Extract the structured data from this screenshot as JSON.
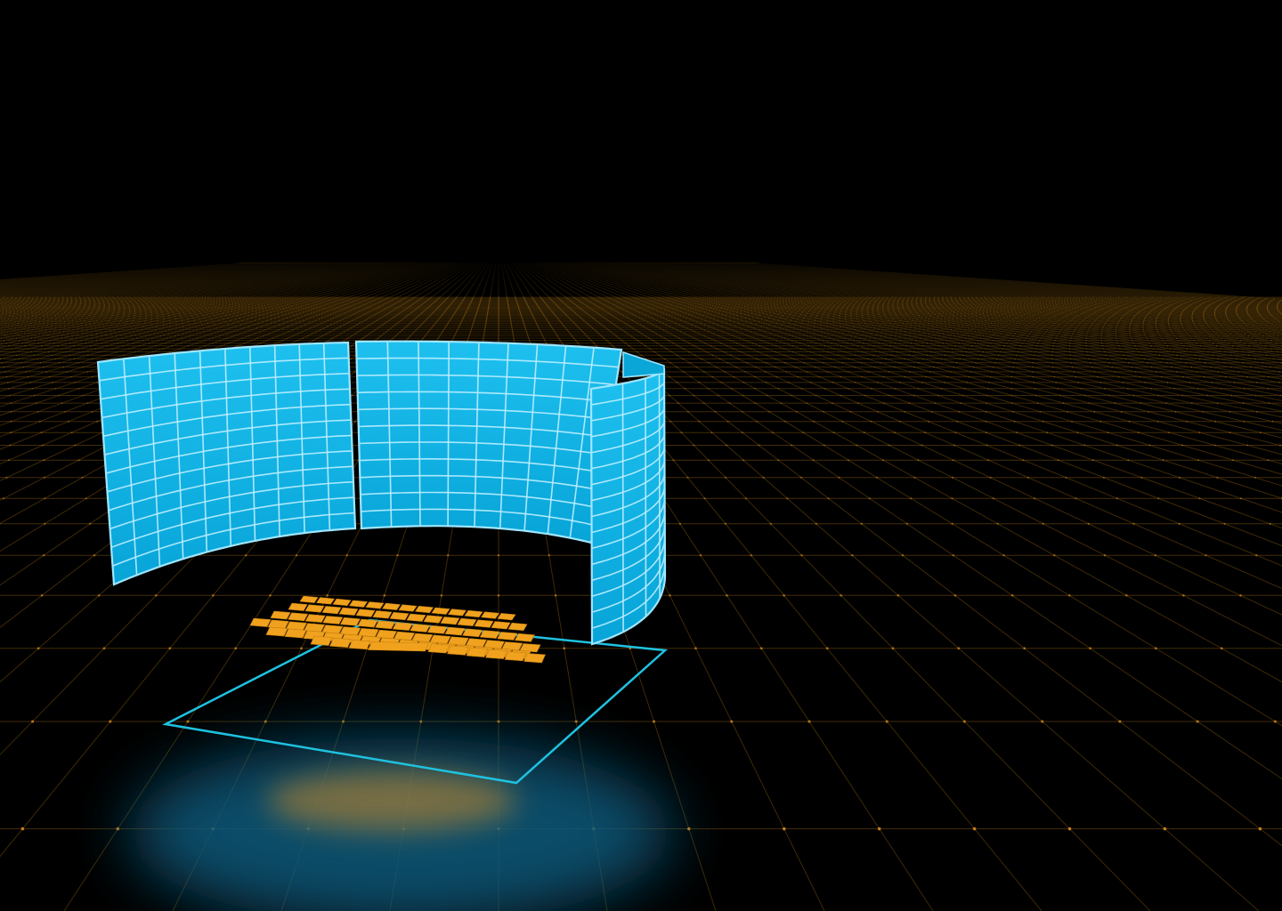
{
  "scene": {
    "kind": "3d-render",
    "background_color": "#000000",
    "floor_grid_line_color": "#4a3208",
    "floor_grid_dot_color": "#e0901a",
    "screen_color": "#06aee0",
    "screen_highlight_color": "#2ac6f2",
    "screen_grid_color": "#bdeeff",
    "screen_edge_color": "#9fe6ff",
    "keyboard_key_color": "#f0a21e",
    "trackpad_outline_color": "#1fc2e0",
    "reflection_color": "#0a5e80"
  }
}
